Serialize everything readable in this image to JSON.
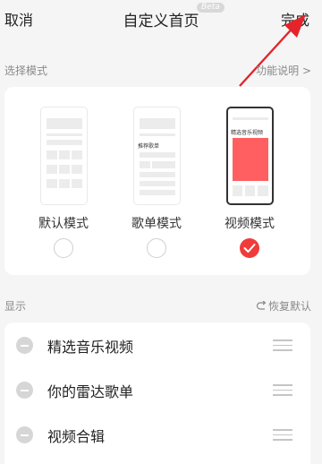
{
  "header": {
    "cancel_label": "取消",
    "title": "自定义首页",
    "beta_badge": "Beta",
    "done_label": "完成"
  },
  "mode_section": {
    "label": "选择模式",
    "help_link": "功能说明 >",
    "modes": [
      {
        "label": "默认模式",
        "selected": false
      },
      {
        "label": "歌单模式",
        "selected": false,
        "preview_text": "推荐歌单"
      },
      {
        "label": "视频模式",
        "selected": true,
        "preview_text": "精选音乐视频"
      }
    ]
  },
  "display_section": {
    "label": "显示",
    "restore_label": "恢复默认",
    "items": [
      {
        "label": "精选音乐视频"
      },
      {
        "label": "你的雷达歌单"
      },
      {
        "label": "视频合辑"
      }
    ]
  },
  "colors": {
    "accent": "#f03b3b",
    "annotation_arrow": "#e5232a",
    "background": "#f5f5f5"
  }
}
